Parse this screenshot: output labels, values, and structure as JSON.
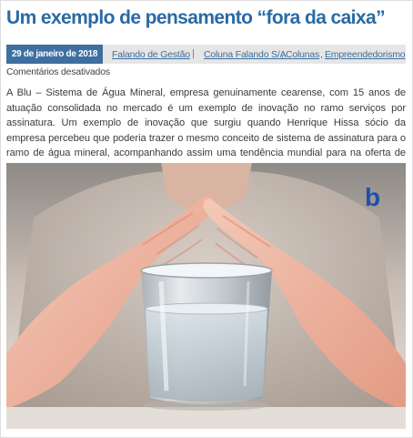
{
  "article": {
    "title": "Um exemplo de pensamento “fora da caixa”",
    "date": "29 de janeiro de 2018",
    "author_link": "Falando de Gestão",
    "categories": [
      "Coluna Falando S/A",
      "Colunas",
      "Empreendedorismo"
    ],
    "comments_status": "Comentários desativados",
    "paragraph": "A Blu – Sistema de Água Mineral, empresa genuinamente cearense, com 15 anos de atuação consolidada no mercado é um exemplo de inovação no ramo serviços por assinatura. Um exemplo de inovação que surgiu quando Henrique Hissa sócio da empresa percebeu que poderia trazer o mesmo conceito de sistema de assinatura para o ramo de água mineral, acompanhando assim uma tendência mundial para na oferta de serviços.",
    "image_logo_letter": "b"
  },
  "colors": {
    "title": "#2a6aa5",
    "date_badge": "#3e6fa0",
    "link": "#3c6d9c",
    "logo": "#1f4fae"
  }
}
